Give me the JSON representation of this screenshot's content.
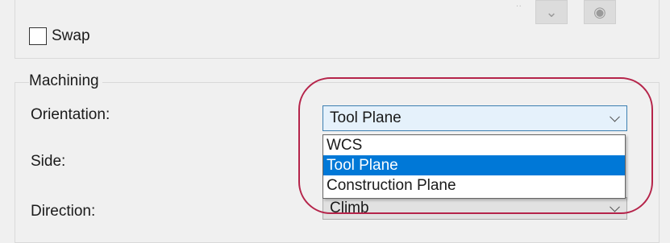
{
  "top": {
    "swap_label": "Swap",
    "swap_checked": false,
    "icons": [
      "chevron-down-icon",
      "eye-icon"
    ]
  },
  "machining": {
    "title": "Machining",
    "orientation": {
      "label": "Orientation:",
      "selected": "Tool Plane",
      "options": [
        "WCS",
        "Tool Plane",
        "Construction Plane"
      ],
      "selected_index": 1
    },
    "side": {
      "label": "Side:"
    },
    "direction": {
      "label": "Direction:",
      "value": "Climb"
    }
  },
  "colors": {
    "highlight_oval": "#b5244a",
    "selection": "#0078d7",
    "combo_active_bg": "#e5f1fb"
  }
}
